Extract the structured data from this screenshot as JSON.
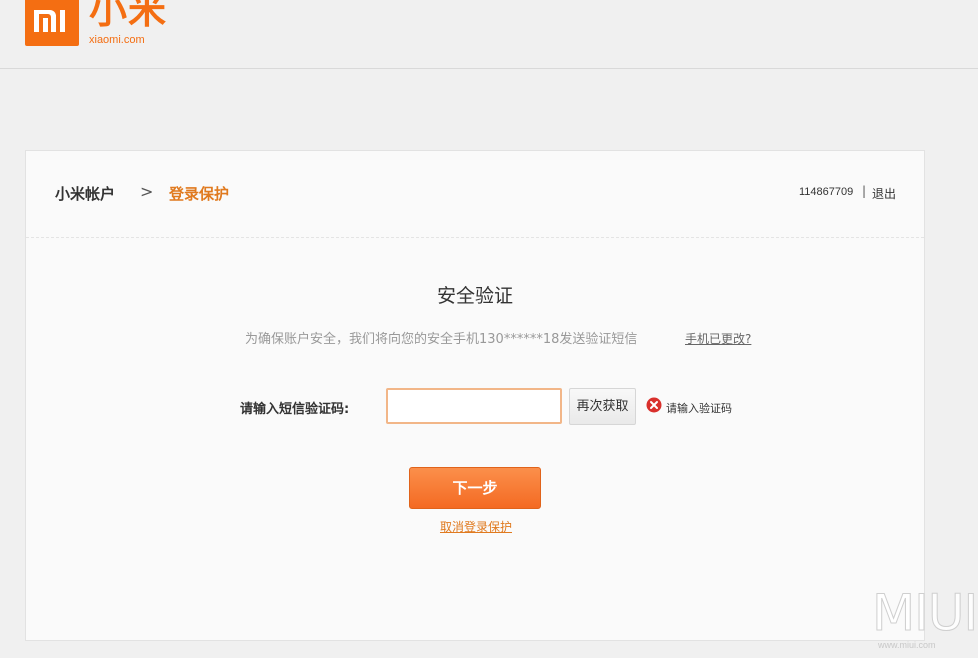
{
  "brand": {
    "name": "小米",
    "domain": "xiaomi.com",
    "color": "#f46e12"
  },
  "header": {
    "breadcrumb_root": "小米帐户",
    "breadcrumb_separator": ">",
    "breadcrumb_current": "登录保护",
    "user_id": "114867709",
    "separator": "|",
    "logout": "退出"
  },
  "main": {
    "title": "安全验证",
    "notice": "为确保账户安全，我们将向您的安全手机130******18发送验证短信",
    "change_phone_link": "手机已更改?",
    "field_label": "请输入短信验证码:",
    "code_value": "",
    "resend_button": "再次获取",
    "error_message": "请输入验证码",
    "next_button": "下一步",
    "cancel_link": "取消登录保护"
  },
  "watermark": {
    "logo": "MIUI",
    "url": "www.miui.com"
  },
  "colors": {
    "accent": "#e07a1f",
    "button": "#f46a22",
    "error": "#d9302c"
  }
}
